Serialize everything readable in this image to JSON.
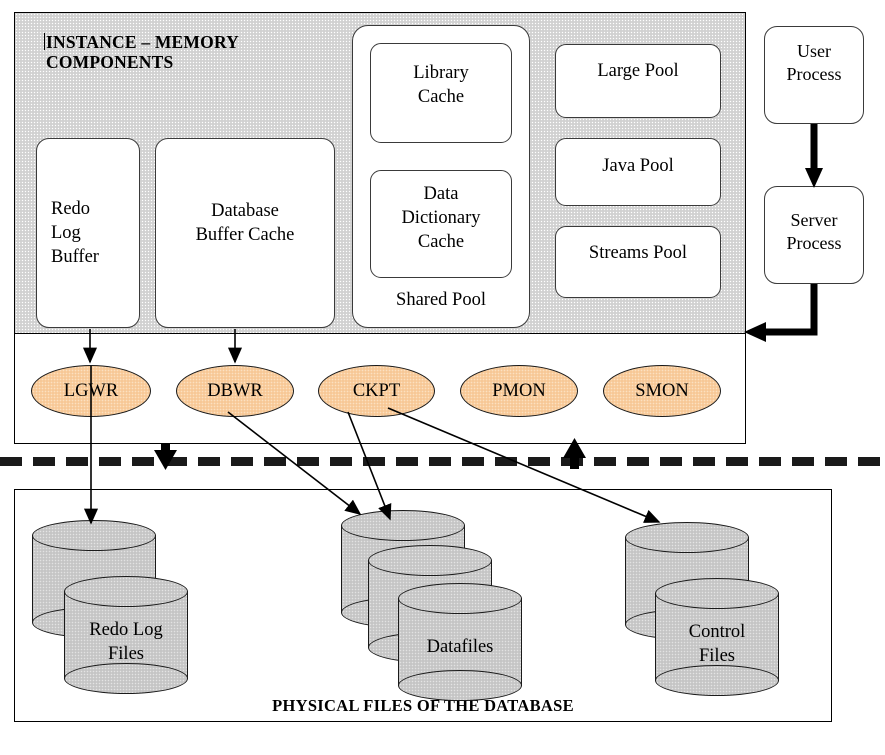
{
  "diagram": {
    "instance": {
      "title": "INSTANCE – MEMORY\nCOMPONENTS",
      "memory_components": [
        {
          "id": "redo-log-buffer",
          "label": "Redo\nLog\nBuffer"
        },
        {
          "id": "database-buffer-cache",
          "label": "Database\nBuffer Cache"
        },
        {
          "id": "shared-pool",
          "label": "Shared Pool"
        },
        {
          "id": "library-cache",
          "label": "Library\nCache"
        },
        {
          "id": "data-dictionary-cache",
          "label": "Data\nDictionary\nCache"
        },
        {
          "id": "large-pool",
          "label": "Large Pool"
        },
        {
          "id": "java-pool",
          "label": "Java Pool"
        },
        {
          "id": "streams-pool",
          "label": "Streams Pool"
        }
      ],
      "background_processes": [
        {
          "id": "lgwr",
          "label": "LGWR"
        },
        {
          "id": "dbwr",
          "label": "DBWR"
        },
        {
          "id": "ckpt",
          "label": "CKPT"
        },
        {
          "id": "pmon",
          "label": "PMON"
        },
        {
          "id": "smon",
          "label": "SMON"
        }
      ]
    },
    "client_processes": [
      {
        "id": "user-process",
        "label": "User\nProcess"
      },
      {
        "id": "server-process",
        "label": "Server\nProcess"
      }
    ],
    "physical": {
      "caption": "PHYSICAL FILES OF THE DATABASE",
      "file_groups": [
        {
          "id": "redo-log-files",
          "label": "Redo Log\nFiles",
          "cylinders": 2
        },
        {
          "id": "datafiles",
          "label": "Datafiles",
          "cylinders": 3
        },
        {
          "id": "control-files",
          "label": "Control\nFiles",
          "cylinders": 2
        }
      ]
    },
    "connections": [
      {
        "from": "redo-log-buffer",
        "to": "lgwr"
      },
      {
        "from": "database-buffer-cache",
        "to": "dbwr"
      },
      {
        "from": "lgwr",
        "to": "redo-log-files"
      },
      {
        "from": "dbwr",
        "to": "datafiles"
      },
      {
        "from": "ckpt",
        "to": "datafiles"
      },
      {
        "from": "ckpt",
        "to": "control-files"
      },
      {
        "from": "user-process",
        "to": "server-process"
      },
      {
        "from": "server-process",
        "to": "instance"
      }
    ],
    "colors": {
      "sga_background": "#d6d6d6",
      "process_oval_fill": "#f9cfa1",
      "cylinder_fill": "#cbcbcb",
      "box_fill": "#ffffff",
      "line": "#000000"
    }
  }
}
